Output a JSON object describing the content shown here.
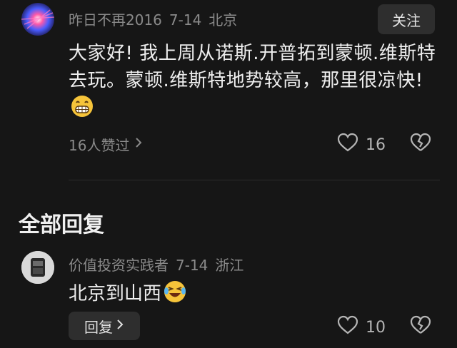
{
  "comment": {
    "username": "昨日不再2016",
    "date": "7-14",
    "location": "北京",
    "follow_label": "关注",
    "text": "大家好! 我上周从诺斯.开普拓到蒙顿.维斯特去玩。蒙顿.维斯特地势较高，那里很凉快!",
    "emoji": "grinning-face-emoji",
    "likers_summary": "16人赞过",
    "like_count": "16"
  },
  "section_title": "全部回复",
  "reply": {
    "username": "价值投资实践者",
    "date": "7-14",
    "location": "浙江",
    "text": "北京到山西",
    "emoji": "rolling-laughing-emoji",
    "reply_label": "回复",
    "like_count": "10"
  }
}
